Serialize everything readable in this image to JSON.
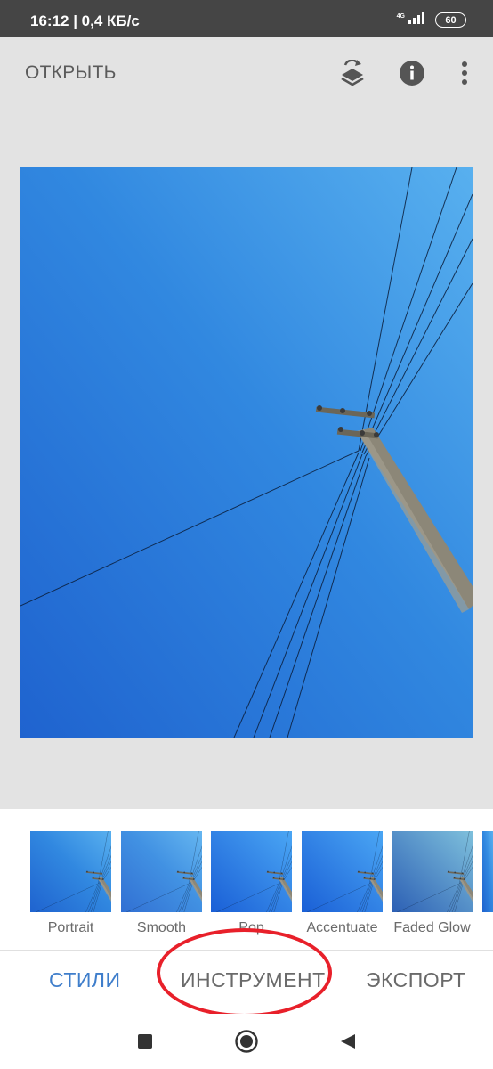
{
  "status_bar": {
    "time": "16:12 | 0,4 КБ/с",
    "network": "4G",
    "battery": "60"
  },
  "app_bar": {
    "open_label": "ОТКРЫТЬ",
    "icons": [
      "layers-history-icon",
      "info-icon",
      "more-vert-icon"
    ]
  },
  "looks": [
    {
      "label": "Portrait"
    },
    {
      "label": "Smooth"
    },
    {
      "label": "Pop"
    },
    {
      "label": "Accentuate"
    },
    {
      "label": "Faded Glow"
    }
  ],
  "tabs": {
    "styles": "СТИЛИ",
    "tools": "ИНСТРУМЕНТ",
    "export": "ЭКСПОРТ"
  },
  "colors": {
    "accent": "#3f7ecb",
    "status_bar": "#454545",
    "annotation_circle": "#e8202a",
    "sky": "#2f86e0"
  }
}
